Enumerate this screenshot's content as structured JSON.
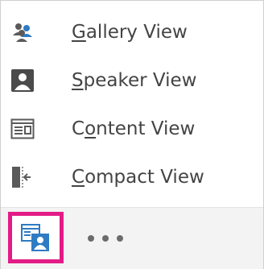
{
  "menu": {
    "items": [
      {
        "pre": "",
        "key": "G",
        "post": "allery View",
        "icon": "gallery-view-icon"
      },
      {
        "pre": "",
        "key": "S",
        "post": "peaker View",
        "icon": "speaker-view-icon"
      },
      {
        "pre": "C",
        "key": "o",
        "post": "ntent View",
        "icon": "content-view-icon"
      },
      {
        "pre": "",
        "key": "C",
        "post": "ompact View",
        "icon": "compact-view-icon"
      }
    ]
  },
  "bottom_bar": {
    "view_toggle_icon": "meeting-view-icon",
    "more_icon": "ellipsis-icon"
  },
  "colors": {
    "accent": "#2e7bc4",
    "highlight_border": "#e31b86",
    "text": "#444444"
  }
}
